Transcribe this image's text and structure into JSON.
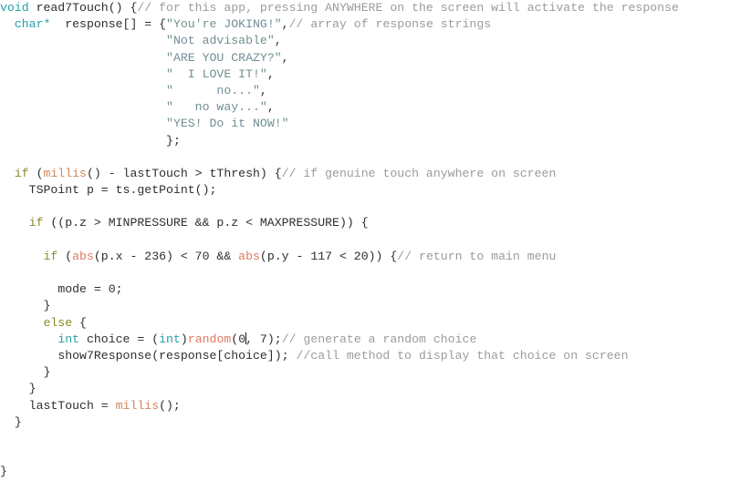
{
  "document": {
    "kind": "source-code-listing",
    "language": "arduino-cpp",
    "colors": {
      "background": "#ffffff",
      "plain": "#2e2e2e",
      "keyword": "#8a8a28",
      "type": "#27a0a8",
      "function": "#d0875a",
      "function_alt": "#e07a5f",
      "string": "#6f8f93",
      "comment": "#9b9b9b",
      "caret": "#1a1a1a"
    },
    "caret": {
      "present": true,
      "line_index": 19,
      "after_text": "random(0"
    }
  },
  "code": {
    "lines": [
      {
        "indent": 0,
        "tokens": [
          {
            "c": "type",
            "t": "void"
          },
          {
            "c": "plain",
            "t": " read7Touch() {"
          },
          {
            "c": "comment",
            "t": "// for this app, pressing ANYWHERE on the screen will activate the response"
          }
        ]
      },
      {
        "indent": 2,
        "tokens": [
          {
            "c": "type",
            "t": "char*"
          },
          {
            "c": "plain",
            "t": "  response[] = {"
          },
          {
            "c": "string",
            "t": "\"You're JOKING!\""
          },
          {
            "c": "plain",
            "t": ","
          },
          {
            "c": "comment",
            "t": "// array of response strings"
          }
        ]
      },
      {
        "indent": 23,
        "tokens": [
          {
            "c": "string",
            "t": "\"Not advisable\""
          },
          {
            "c": "plain",
            "t": ","
          }
        ]
      },
      {
        "indent": 23,
        "tokens": [
          {
            "c": "string",
            "t": "\"ARE YOU CRAZY?\""
          },
          {
            "c": "plain",
            "t": ","
          }
        ]
      },
      {
        "indent": 23,
        "tokens": [
          {
            "c": "string",
            "t": "\"  I LOVE IT!\""
          },
          {
            "c": "plain",
            "t": ","
          }
        ]
      },
      {
        "indent": 23,
        "tokens": [
          {
            "c": "string",
            "t": "\"      no...\""
          },
          {
            "c": "plain",
            "t": ","
          }
        ]
      },
      {
        "indent": 23,
        "tokens": [
          {
            "c": "string",
            "t": "\"   no way...\""
          },
          {
            "c": "plain",
            "t": ","
          }
        ]
      },
      {
        "indent": 23,
        "tokens": [
          {
            "c": "string",
            "t": "\"YES! Do it NOW!\""
          }
        ]
      },
      {
        "indent": 23,
        "tokens": [
          {
            "c": "plain",
            "t": "};"
          }
        ]
      },
      {
        "indent": 0,
        "tokens": []
      },
      {
        "indent": 2,
        "tokens": [
          {
            "c": "keyword",
            "t": "if"
          },
          {
            "c": "plain",
            "t": " ("
          },
          {
            "c": "func",
            "t": "millis"
          },
          {
            "c": "plain",
            "t": "() - lastTouch > tThresh) {"
          },
          {
            "c": "comment",
            "t": "// if genuine touch anywhere on screen"
          }
        ]
      },
      {
        "indent": 4,
        "tokens": [
          {
            "c": "plain",
            "t": "TSPoint p = ts.getPoint();"
          }
        ]
      },
      {
        "indent": 0,
        "tokens": []
      },
      {
        "indent": 4,
        "tokens": [
          {
            "c": "keyword",
            "t": "if"
          },
          {
            "c": "plain",
            "t": " ((p.z > MINPRESSURE && p.z < MAXPRESSURE)) {"
          }
        ]
      },
      {
        "indent": 0,
        "tokens": []
      },
      {
        "indent": 6,
        "tokens": [
          {
            "c": "keyword",
            "t": "if"
          },
          {
            "c": "plain",
            "t": " ("
          },
          {
            "c": "func2",
            "t": "abs"
          },
          {
            "c": "plain",
            "t": "(p.x - 236) < 70 && "
          },
          {
            "c": "func2",
            "t": "abs"
          },
          {
            "c": "plain",
            "t": "(p.y - 117 < 20)) {"
          },
          {
            "c": "comment",
            "t": "// return to main menu"
          }
        ]
      },
      {
        "indent": 0,
        "tokens": []
      },
      {
        "indent": 8,
        "tokens": [
          {
            "c": "plain",
            "t": "mode = 0;"
          }
        ]
      },
      {
        "indent": 6,
        "tokens": [
          {
            "c": "plain",
            "t": "}"
          }
        ]
      },
      {
        "indent": 6,
        "tokens": [
          {
            "c": "keyword",
            "t": "else"
          },
          {
            "c": "plain",
            "t": " {"
          }
        ]
      },
      {
        "indent": 8,
        "tokens": [
          {
            "c": "type",
            "t": "int"
          },
          {
            "c": "plain",
            "t": " choice = ("
          },
          {
            "c": "type",
            "t": "int"
          },
          {
            "c": "plain",
            "t": ")"
          },
          {
            "c": "func2",
            "t": "random"
          },
          {
            "c": "plain",
            "t": "(0"
          },
          {
            "c": "caret",
            "t": ""
          },
          {
            "c": "plain",
            "t": ", 7);"
          },
          {
            "c": "comment",
            "t": "// generate a random choice"
          }
        ]
      },
      {
        "indent": 8,
        "tokens": [
          {
            "c": "plain",
            "t": "show7Response(response[choice]); "
          },
          {
            "c": "comment",
            "t": "//call method to display that choice on screen"
          }
        ]
      },
      {
        "indent": 6,
        "tokens": [
          {
            "c": "plain",
            "t": "}"
          }
        ]
      },
      {
        "indent": 4,
        "tokens": [
          {
            "c": "plain",
            "t": "}"
          }
        ]
      },
      {
        "indent": 4,
        "tokens": [
          {
            "c": "plain",
            "t": "lastTouch = "
          },
          {
            "c": "func",
            "t": "millis"
          },
          {
            "c": "plain",
            "t": "();"
          }
        ]
      },
      {
        "indent": 2,
        "tokens": [
          {
            "c": "plain",
            "t": "}"
          }
        ]
      },
      {
        "indent": 0,
        "tokens": []
      },
      {
        "indent": 0,
        "tokens": []
      },
      {
        "indent": 0,
        "tokens": [
          {
            "c": "plain",
            "t": "}"
          }
        ]
      }
    ]
  }
}
